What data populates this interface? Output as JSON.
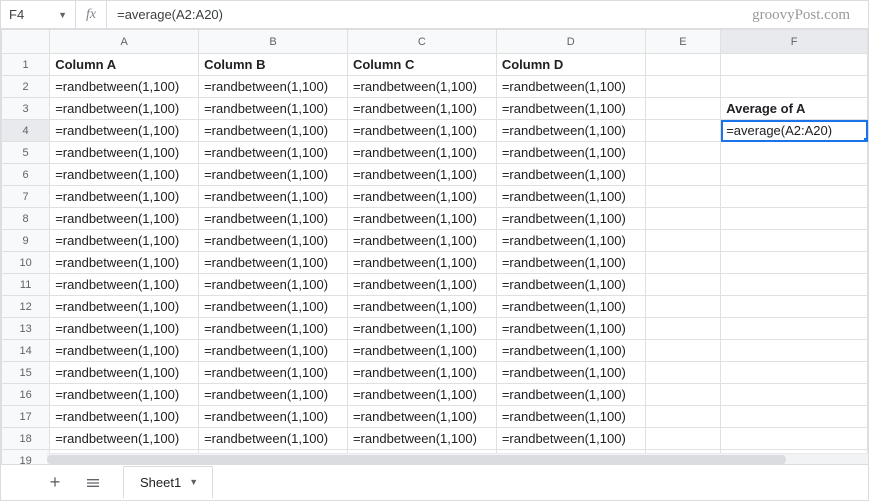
{
  "watermark": "groovyPost.com",
  "nameBox": "F4",
  "formula": "=average(A2:A20)",
  "columns": [
    "A",
    "B",
    "C",
    "D",
    "E",
    "F"
  ],
  "selectedCell": {
    "col": "F",
    "row": 4
  },
  "grid": {
    "headerRow": [
      "Column A",
      "Column B",
      "Column C",
      "Column D",
      "",
      ""
    ],
    "dataFormula": "=randbetween(1,100)",
    "dataRows": 18,
    "fLabels": {
      "3": "Average of A",
      "4": "=average(A2:A20)"
    }
  },
  "sheets": {
    "active": "Sheet1"
  }
}
